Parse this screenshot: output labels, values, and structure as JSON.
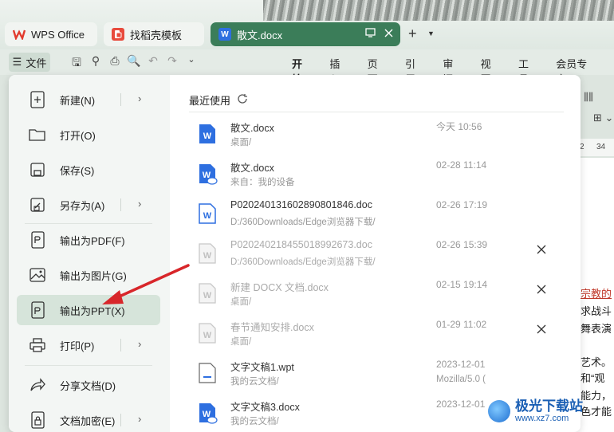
{
  "tabs": [
    {
      "label": "WPS Office",
      "icon": "wps-logo-icon"
    },
    {
      "label": "找稻壳模板",
      "icon": "docer-logo-icon"
    },
    {
      "label": "散文.docx",
      "icon": "word-doc-icon",
      "active": true
    }
  ],
  "toolbar": {
    "file_label": "文件",
    "ribbon_tabs": [
      "开始",
      "插入",
      "页面",
      "引用",
      "审阅",
      "视图",
      "工具",
      "会员专享"
    ],
    "active_tab": "开始"
  },
  "file_menu": {
    "items": [
      {
        "label": "新建(N)",
        "icon": "new-file-icon",
        "submenu": true
      },
      {
        "label": "打开(O)",
        "icon": "folder-open-icon"
      },
      {
        "label": "保存(S)",
        "icon": "save-icon"
      },
      {
        "label": "另存为(A)",
        "icon": "save-as-icon",
        "submenu": true
      },
      {
        "label": "输出为PDF(F)",
        "icon": "export-pdf-icon"
      },
      {
        "label": "输出为图片(G)",
        "icon": "export-image-icon"
      },
      {
        "label": "输出为PPT(X)",
        "icon": "export-ppt-icon",
        "highlighted": true
      },
      {
        "label": "打印(P)",
        "icon": "print-icon",
        "submenu": true
      },
      {
        "label": "分享文档(D)",
        "icon": "share-icon"
      },
      {
        "label": "文档加密(E)",
        "icon": "encrypt-icon",
        "submenu": true
      }
    ]
  },
  "recent": {
    "title": "最近使用",
    "files": [
      {
        "name": "散文.docx",
        "path": "桌面/",
        "date": "今天 10:56",
        "extra": "",
        "type": "word",
        "faded": false,
        "closable": false
      },
      {
        "name": "散文.docx",
        "path": "来自：我的设备",
        "date": "02-28 11:14",
        "extra": "",
        "type": "word-cloud",
        "faded": false,
        "closable": false
      },
      {
        "name": "P020240131602890801846.doc",
        "path": "D:/360Downloads/Edge浏览器下载/",
        "date": "02-26 17:19",
        "extra": "",
        "type": "word-outline",
        "faded": false,
        "closable": false
      },
      {
        "name": "P020240218455018992673.doc",
        "path": "D:/360Downloads/Edge浏览器下载/",
        "date": "02-26 15:39",
        "extra": "",
        "type": "word-gray",
        "faded": true,
        "closable": true
      },
      {
        "name": "新建 DOCX 文档.docx",
        "path": "桌面/",
        "date": "02-15 19:14",
        "extra": "",
        "type": "word-gray",
        "faded": true,
        "closable": true
      },
      {
        "name": "春节通知安排.docx",
        "path": "桌面/",
        "date": "01-29 11:02",
        "extra": "",
        "type": "word-gray",
        "faded": true,
        "closable": true
      },
      {
        "name": "文字文稿1.wpt",
        "path": "我的云文档/",
        "date": "2023-12-01",
        "extra": "Mozilla/5.0 (",
        "type": "template",
        "faded": false,
        "closable": false
      },
      {
        "name": "文字文稿3.docx",
        "path": "我的云文档/",
        "date": "2023-12-01",
        "extra": "",
        "type": "word-cloud",
        "faded": false,
        "closable": false
      }
    ]
  },
  "document_behind": {
    "ruler_labels": [
      "2",
      "34"
    ],
    "lines": [
      "宗教的",
      "求战斗",
      "舞表演",
      "艺术。",
      "和“观",
      "能力，",
      "色才能"
    ]
  },
  "watermark": {
    "title": "极光下载站",
    "url": "www.xz7.com"
  }
}
